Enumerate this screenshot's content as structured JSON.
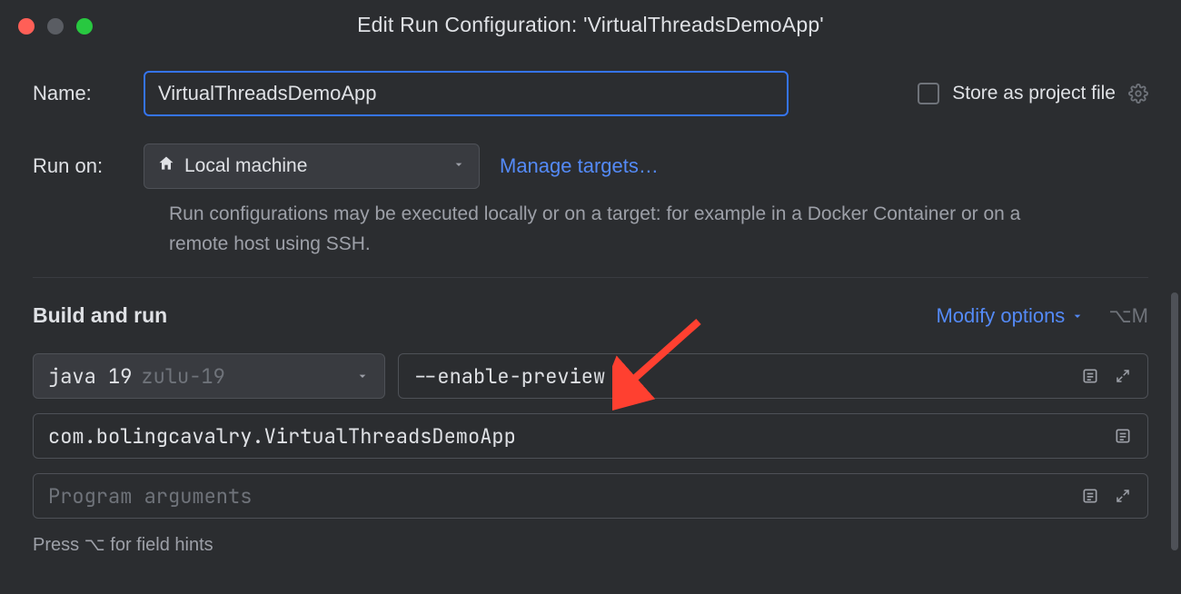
{
  "window": {
    "title": "Edit Run Configuration: 'VirtualThreadsDemoApp'"
  },
  "form": {
    "name_label": "Name:",
    "name_value": "VirtualThreadsDemoApp",
    "store_label": "Store as project file",
    "run_on_label": "Run on:",
    "run_on_value": "Local machine",
    "manage_targets": "Manage targets…",
    "run_on_hint": "Run configurations may be executed locally or on a target: for example in a Docker Container or on a remote host using SSH."
  },
  "build": {
    "section_title": "Build and run",
    "modify_label": "Modify options",
    "modify_shortcut": "⌥M",
    "sdk_main": "java 19",
    "sdk_sub": "zulu-19",
    "vm_options": "--enable-preview",
    "main_class": "com.bolingcavalry.VirtualThreadsDemoApp",
    "program_args_placeholder": "Program arguments",
    "hint": "Press ⌥ for field hints"
  }
}
